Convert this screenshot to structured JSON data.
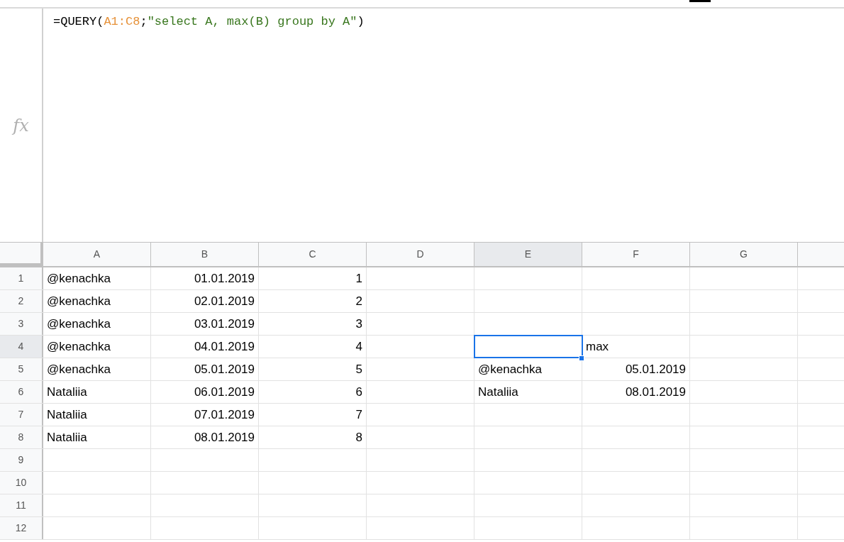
{
  "formula_bar": {
    "label": "fx",
    "formula": [
      {
        "text": "=QUERY(",
        "kind": "plain"
      },
      {
        "text": "A1:C8",
        "kind": "range"
      },
      {
        "text": ";",
        "kind": "plain"
      },
      {
        "text": "\"select A, max(B) group by A\"",
        "kind": "string"
      },
      {
        "text": ")",
        "kind": "plain"
      }
    ]
  },
  "columns": [
    {
      "label": "A",
      "selected": false
    },
    {
      "label": "B",
      "selected": false
    },
    {
      "label": "C",
      "selected": false
    },
    {
      "label": "D",
      "selected": false
    },
    {
      "label": "E",
      "selected": true
    },
    {
      "label": "F",
      "selected": false
    },
    {
      "label": "G",
      "selected": false
    }
  ],
  "rows": [
    {
      "label": "1",
      "selected": false,
      "cells": [
        {
          "text": "@kenachka",
          "kind": "text",
          "selected": false
        },
        {
          "text": "01.01.2019",
          "kind": "number",
          "selected": false
        },
        {
          "text": "1",
          "kind": "number",
          "selected": false
        },
        null,
        null,
        null,
        null
      ]
    },
    {
      "label": "2",
      "selected": false,
      "cells": [
        {
          "text": "@kenachka",
          "kind": "text",
          "selected": false
        },
        {
          "text": "02.01.2019",
          "kind": "number",
          "selected": false
        },
        {
          "text": "2",
          "kind": "number",
          "selected": false
        },
        null,
        null,
        null,
        null
      ]
    },
    {
      "label": "3",
      "selected": false,
      "cells": [
        {
          "text": "@kenachka",
          "kind": "text",
          "selected": false
        },
        {
          "text": "03.01.2019",
          "kind": "number",
          "selected": false
        },
        {
          "text": "3",
          "kind": "number",
          "selected": false
        },
        null,
        null,
        null,
        null
      ]
    },
    {
      "label": "4",
      "selected": true,
      "cells": [
        {
          "text": "@kenachka",
          "kind": "text",
          "selected": false
        },
        {
          "text": "04.01.2019",
          "kind": "number",
          "selected": false
        },
        {
          "text": "4",
          "kind": "number",
          "selected": false
        },
        null,
        {
          "selected": true
        },
        {
          "text": "max",
          "kind": "text",
          "selected": false
        },
        null
      ]
    },
    {
      "label": "5",
      "selected": false,
      "cells": [
        {
          "text": "@kenachka",
          "kind": "text",
          "selected": false
        },
        {
          "text": "05.01.2019",
          "kind": "number",
          "selected": false
        },
        {
          "text": "5",
          "kind": "number",
          "selected": false
        },
        null,
        {
          "text": "@kenachka",
          "kind": "text",
          "selected": false
        },
        {
          "text": "05.01.2019",
          "kind": "number",
          "selected": false
        },
        null
      ]
    },
    {
      "label": "6",
      "selected": false,
      "cells": [
        {
          "text": "Nataliia",
          "kind": "text",
          "selected": false
        },
        {
          "text": "06.01.2019",
          "kind": "number",
          "selected": false
        },
        {
          "text": "6",
          "kind": "number",
          "selected": false
        },
        null,
        {
          "text": "Nataliia",
          "kind": "text",
          "selected": false
        },
        {
          "text": "08.01.2019",
          "kind": "number",
          "selected": false
        },
        null
      ]
    },
    {
      "label": "7",
      "selected": false,
      "cells": [
        {
          "text": "Nataliia",
          "kind": "text",
          "selected": false
        },
        {
          "text": "07.01.2019",
          "kind": "number",
          "selected": false
        },
        {
          "text": "7",
          "kind": "number",
          "selected": false
        },
        null,
        null,
        null,
        null
      ]
    },
    {
      "label": "8",
      "selected": false,
      "cells": [
        {
          "text": "Nataliia",
          "kind": "text",
          "selected": false
        },
        {
          "text": "08.01.2019",
          "kind": "number",
          "selected": false
        },
        {
          "text": "8",
          "kind": "number",
          "selected": false
        },
        null,
        null,
        null,
        null
      ]
    },
    {
      "label": "9",
      "selected": false,
      "cells": [
        null,
        null,
        null,
        null,
        null,
        null,
        null
      ]
    },
    {
      "label": "10",
      "selected": false,
      "cells": [
        null,
        null,
        null,
        null,
        null,
        null,
        null
      ]
    },
    {
      "label": "11",
      "selected": false,
      "cells": [
        null,
        null,
        null,
        null,
        null,
        null,
        null
      ]
    },
    {
      "label": "12",
      "selected": false,
      "cells": [
        null,
        null,
        null,
        null,
        null,
        null,
        null
      ]
    }
  ]
}
